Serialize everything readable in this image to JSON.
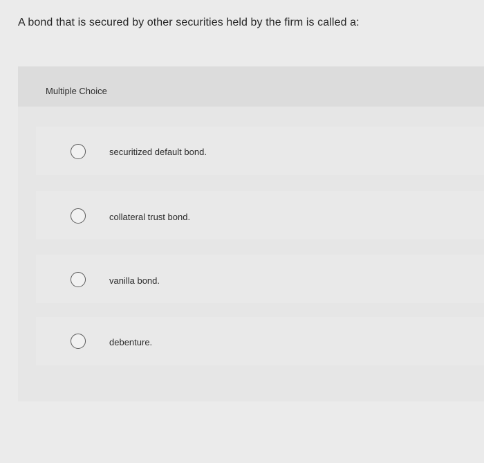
{
  "question": {
    "text": "A bond that is secured by other securities held by the firm is called a:"
  },
  "card": {
    "header_label": "Multiple Choice"
  },
  "options": [
    {
      "label": "securitized default bond.",
      "selected": false
    },
    {
      "label": "collateral trust bond.",
      "selected": false
    },
    {
      "label": "vanilla bond.",
      "selected": false
    },
    {
      "label": "debenture.",
      "selected": false
    }
  ]
}
